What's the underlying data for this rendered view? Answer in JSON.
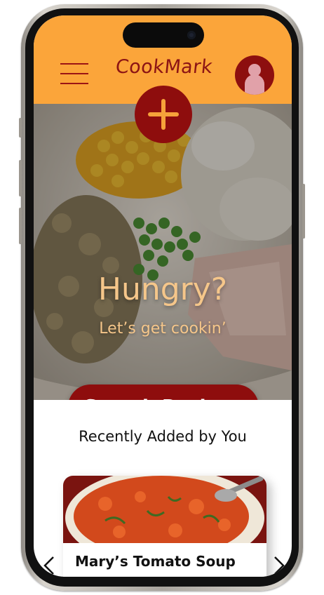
{
  "app": {
    "name": "CookMark"
  },
  "header": {
    "menu_icon": "hamburger-menu-icon",
    "avatar_icon": "user-avatar-icon",
    "add_icon": "plus-icon",
    "colors": {
      "header_bg": "#fba53a",
      "brand_red": "#8e0d0d",
      "hero_text": "#f5c68a"
    }
  },
  "hero": {
    "title": "Hungry?",
    "subtitle": "Let’s get cookin’",
    "search_button": "Search Recipes"
  },
  "recent": {
    "heading": "Recently Added by You",
    "cards": [
      {
        "title": "Mary’s Tomato Soup"
      }
    ],
    "prev_icon": "chevron-left-icon",
    "next_icon": "chevron-right-icon"
  }
}
